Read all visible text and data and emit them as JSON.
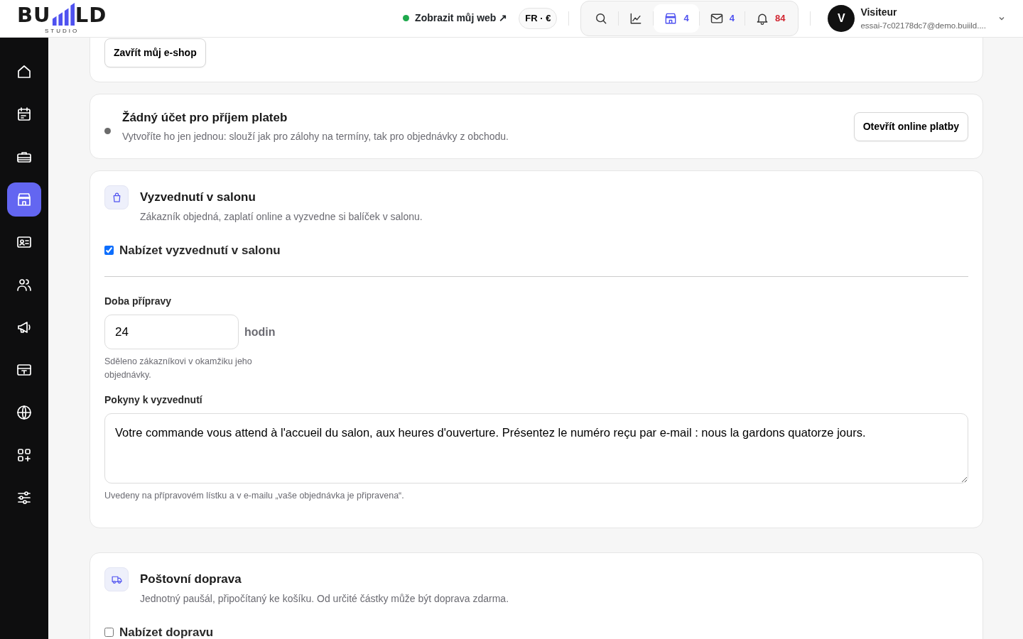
{
  "logo": {
    "left": "BU",
    "right": "LD",
    "sub": "STUDIO"
  },
  "header": {
    "site_link": {
      "label": "Zobrazit můj web ↗",
      "online": true
    },
    "locale": {
      "language": "FR",
      "separator": "·",
      "currency": "€"
    },
    "toolbar": [
      {
        "kind": "search",
        "selected": false
      },
      {
        "kind": "stats",
        "selected": false
      },
      {
        "kind": "shop",
        "count": "4",
        "selected": true
      },
      {
        "kind": "mail",
        "count": "4",
        "selected": false
      },
      {
        "kind": "bell",
        "count": "84",
        "selected": false,
        "alert": true
      }
    ],
    "user": {
      "initial": "V",
      "name": "Visiteur",
      "email": "essai-7c02178dc7@demo.buiild...."
    }
  },
  "sidebar": {
    "items": [
      {
        "kind": "home",
        "selected": false
      },
      {
        "kind": "calendar",
        "selected": false
      },
      {
        "kind": "toolbox",
        "selected": false
      },
      {
        "kind": "shop",
        "selected": true
      },
      {
        "kind": "contact",
        "selected": false
      },
      {
        "kind": "users",
        "selected": false
      },
      {
        "kind": "megaphone",
        "selected": false
      },
      {
        "kind": "register",
        "selected": false
      },
      {
        "kind": "globe",
        "selected": false
      },
      {
        "kind": "apps",
        "selected": false
      },
      {
        "kind": "sliders",
        "selected": false
      }
    ]
  },
  "top_card": {
    "button": "Zavřít můj e-shop"
  },
  "payments": {
    "title": "Žádný účet pro příjem plateb",
    "description": "Vytvoříte ho jen jednou: slouží jak pro zálohy na termíny, tak pro objednávky z obchodu.",
    "connected": false,
    "button": "Otevřít online platby"
  },
  "methods": [
    {
      "kind": "pickup",
      "title": "Vyzvednutí v salonu",
      "description": "Zákazník objedná, zaplatí online a vyzvedne si balíček v salonu.",
      "option": {
        "label": "Nabízet vyzvednutí v salonu",
        "checked": true
      },
      "fields": [
        {
          "kind": "number",
          "label": "Doba přípravy",
          "value": "24",
          "suffix": "hodin",
          "help": "Sděleno zákazníkovi v okamžiku jeho objednávky."
        },
        {
          "kind": "textarea",
          "label": "Pokyny k vyzvednutí",
          "value": "Votre commande vous attend à l'accueil du salon, aux heures d'ouverture. Présentez le numéro reçu par e-mail : nous la gardons quatorze jours.",
          "help": "Uvedeny na přípravovém lístku a v e-mailu „vaše objednávka je připravena“."
        }
      ]
    },
    {
      "kind": "shipping",
      "title": "Poštovní doprava",
      "description": "Jednotný paušál, připočítaný ke košíku. Od určité částky může být doprava zdarma.",
      "option": {
        "label": "Nabízet dopravu",
        "checked": false
      }
    }
  ]
}
